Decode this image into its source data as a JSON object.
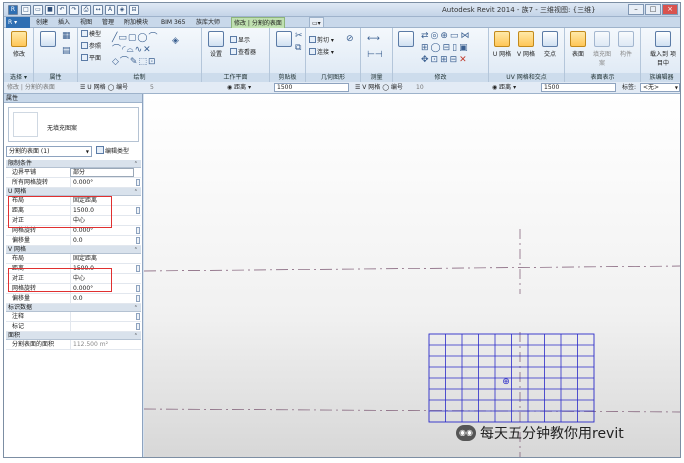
{
  "title_bar": {
    "app_title": "Autodesk Revit 2014 - 族7 - 三维视图: {三维}"
  },
  "tabs": [
    {
      "label": "创建"
    },
    {
      "label": "插入"
    },
    {
      "label": "视图"
    },
    {
      "label": "管理"
    },
    {
      "label": "附加模块"
    },
    {
      "label": "BIM 365"
    },
    {
      "label": "族库大师"
    },
    {
      "label": "修改 | 分割的表面"
    }
  ],
  "ribbon": {
    "groups": {
      "select": "选择 ▾",
      "properties": "属性",
      "draw": "绘制",
      "workplane": "工作平面",
      "clipboard": "剪贴板",
      "geometry": "几何图形",
      "measure": "测量",
      "modify": "修改",
      "uv_grid": "UV 网格和交点",
      "surface_display": "表面表示",
      "family_editor": "族编辑器"
    },
    "buttons": {
      "modify": "修改",
      "model": "模型",
      "ref": "参照",
      "plane": "平面",
      "set": "设置",
      "show": "显示",
      "viewer": "查看器",
      "cut": "剪切",
      "join": "连接",
      "u_grid": "U 网格",
      "v_grid": "V 网格",
      "intersect": "交点",
      "surface": "表面",
      "fill_pattern": "填充图案",
      "component": "构件",
      "load_into_project": "载入到 项目中"
    }
  },
  "options_bar": {
    "modify_label": "修改 | 分割的表面",
    "u_grid": "U 网格",
    "number1": "编号",
    "number1_val": "5",
    "distance1_label": "距离",
    "distance1_val": "1500",
    "v_grid": "V 网格",
    "number2": "编号",
    "number2_val": "10",
    "distance2_label": "距离",
    "distance2_val": "1500",
    "label_label": "标签:",
    "label_val": "<无>"
  },
  "properties": {
    "header": "属性",
    "type_name": "无填充图案",
    "instance": "分割的表面 (1)",
    "edit_type": "编辑类型",
    "sections": [
      {
        "title": "限制条件",
        "rows": [
          {
            "key": "边界平铺",
            "value": "部分"
          },
          {
            "key": "所有网格旋转",
            "value": "0.000°"
          }
        ]
      },
      {
        "title": "U 网格",
        "rows": [
          {
            "key": "布局",
            "value": "固定距离"
          },
          {
            "key": "距离",
            "value": "1500.0"
          },
          {
            "key": "对正",
            "value": "中心"
          },
          {
            "key": "网格旋转",
            "value": "0.000°"
          },
          {
            "key": "偏移量",
            "value": "0.0"
          }
        ]
      },
      {
        "title": "V 网格",
        "rows": [
          {
            "key": "布局",
            "value": "固定距离"
          },
          {
            "key": "距离",
            "value": "1500.0"
          },
          {
            "key": "对正",
            "value": "中心"
          },
          {
            "key": "网格旋转",
            "value": "0.000°"
          },
          {
            "key": "偏移量",
            "value": "0.0"
          }
        ]
      },
      {
        "title": "标识数据",
        "rows": [
          {
            "key": "注释",
            "value": ""
          },
          {
            "key": "标记",
            "value": ""
          }
        ]
      },
      {
        "title": "面积",
        "rows": [
          {
            "key": "分割表面的面积",
            "value": "112.500 m²"
          }
        ]
      }
    ]
  },
  "canvas": {
    "grid_u_count": 5,
    "grid_v_count": 10,
    "colors": {
      "grid": "#2b2bc8",
      "ref_line": "#7a5570"
    }
  },
  "watermark": {
    "text": "每天五分钟教你用revit"
  }
}
